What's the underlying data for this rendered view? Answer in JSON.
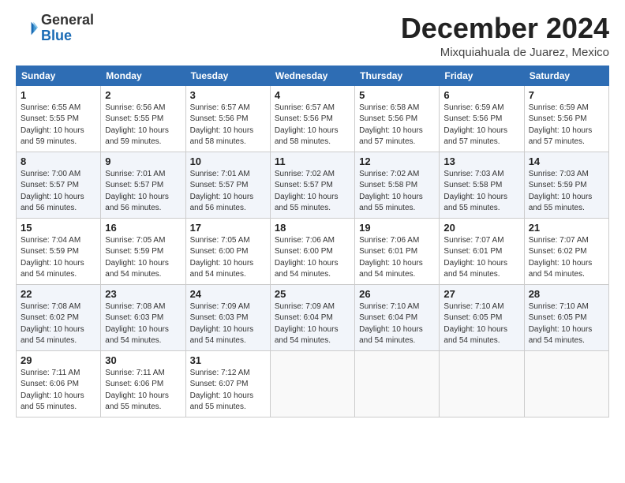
{
  "header": {
    "logo_general": "General",
    "logo_blue": "Blue",
    "month_title": "December 2024",
    "location": "Mixquiahuala de Juarez, Mexico"
  },
  "weekdays": [
    "Sunday",
    "Monday",
    "Tuesday",
    "Wednesday",
    "Thursday",
    "Friday",
    "Saturday"
  ],
  "weeks": [
    [
      {
        "day": "1",
        "sunrise": "6:55 AM",
        "sunset": "5:55 PM",
        "daylight": "10 hours and 59 minutes."
      },
      {
        "day": "2",
        "sunrise": "6:56 AM",
        "sunset": "5:55 PM",
        "daylight": "10 hours and 59 minutes."
      },
      {
        "day": "3",
        "sunrise": "6:57 AM",
        "sunset": "5:56 PM",
        "daylight": "10 hours and 58 minutes."
      },
      {
        "day": "4",
        "sunrise": "6:57 AM",
        "sunset": "5:56 PM",
        "daylight": "10 hours and 58 minutes."
      },
      {
        "day": "5",
        "sunrise": "6:58 AM",
        "sunset": "5:56 PM",
        "daylight": "10 hours and 57 minutes."
      },
      {
        "day": "6",
        "sunrise": "6:59 AM",
        "sunset": "5:56 PM",
        "daylight": "10 hours and 57 minutes."
      },
      {
        "day": "7",
        "sunrise": "6:59 AM",
        "sunset": "5:56 PM",
        "daylight": "10 hours and 57 minutes."
      }
    ],
    [
      {
        "day": "8",
        "sunrise": "7:00 AM",
        "sunset": "5:57 PM",
        "daylight": "10 hours and 56 minutes."
      },
      {
        "day": "9",
        "sunrise": "7:01 AM",
        "sunset": "5:57 PM",
        "daylight": "10 hours and 56 minutes."
      },
      {
        "day": "10",
        "sunrise": "7:01 AM",
        "sunset": "5:57 PM",
        "daylight": "10 hours and 56 minutes."
      },
      {
        "day": "11",
        "sunrise": "7:02 AM",
        "sunset": "5:57 PM",
        "daylight": "10 hours and 55 minutes."
      },
      {
        "day": "12",
        "sunrise": "7:02 AM",
        "sunset": "5:58 PM",
        "daylight": "10 hours and 55 minutes."
      },
      {
        "day": "13",
        "sunrise": "7:03 AM",
        "sunset": "5:58 PM",
        "daylight": "10 hours and 55 minutes."
      },
      {
        "day": "14",
        "sunrise": "7:03 AM",
        "sunset": "5:59 PM",
        "daylight": "10 hours and 55 minutes."
      }
    ],
    [
      {
        "day": "15",
        "sunrise": "7:04 AM",
        "sunset": "5:59 PM",
        "daylight": "10 hours and 54 minutes."
      },
      {
        "day": "16",
        "sunrise": "7:05 AM",
        "sunset": "5:59 PM",
        "daylight": "10 hours and 54 minutes."
      },
      {
        "day": "17",
        "sunrise": "7:05 AM",
        "sunset": "6:00 PM",
        "daylight": "10 hours and 54 minutes."
      },
      {
        "day": "18",
        "sunrise": "7:06 AM",
        "sunset": "6:00 PM",
        "daylight": "10 hours and 54 minutes."
      },
      {
        "day": "19",
        "sunrise": "7:06 AM",
        "sunset": "6:01 PM",
        "daylight": "10 hours and 54 minutes."
      },
      {
        "day": "20",
        "sunrise": "7:07 AM",
        "sunset": "6:01 PM",
        "daylight": "10 hours and 54 minutes."
      },
      {
        "day": "21",
        "sunrise": "7:07 AM",
        "sunset": "6:02 PM",
        "daylight": "10 hours and 54 minutes."
      }
    ],
    [
      {
        "day": "22",
        "sunrise": "7:08 AM",
        "sunset": "6:02 PM",
        "daylight": "10 hours and 54 minutes."
      },
      {
        "day": "23",
        "sunrise": "7:08 AM",
        "sunset": "6:03 PM",
        "daylight": "10 hours and 54 minutes."
      },
      {
        "day": "24",
        "sunrise": "7:09 AM",
        "sunset": "6:03 PM",
        "daylight": "10 hours and 54 minutes."
      },
      {
        "day": "25",
        "sunrise": "7:09 AM",
        "sunset": "6:04 PM",
        "daylight": "10 hours and 54 minutes."
      },
      {
        "day": "26",
        "sunrise": "7:10 AM",
        "sunset": "6:04 PM",
        "daylight": "10 hours and 54 minutes."
      },
      {
        "day": "27",
        "sunrise": "7:10 AM",
        "sunset": "6:05 PM",
        "daylight": "10 hours and 54 minutes."
      },
      {
        "day": "28",
        "sunrise": "7:10 AM",
        "sunset": "6:05 PM",
        "daylight": "10 hours and 54 minutes."
      }
    ],
    [
      {
        "day": "29",
        "sunrise": "7:11 AM",
        "sunset": "6:06 PM",
        "daylight": "10 hours and 55 minutes."
      },
      {
        "day": "30",
        "sunrise": "7:11 AM",
        "sunset": "6:06 PM",
        "daylight": "10 hours and 55 minutes."
      },
      {
        "day": "31",
        "sunrise": "7:12 AM",
        "sunset": "6:07 PM",
        "daylight": "10 hours and 55 minutes."
      },
      null,
      null,
      null,
      null
    ]
  ]
}
